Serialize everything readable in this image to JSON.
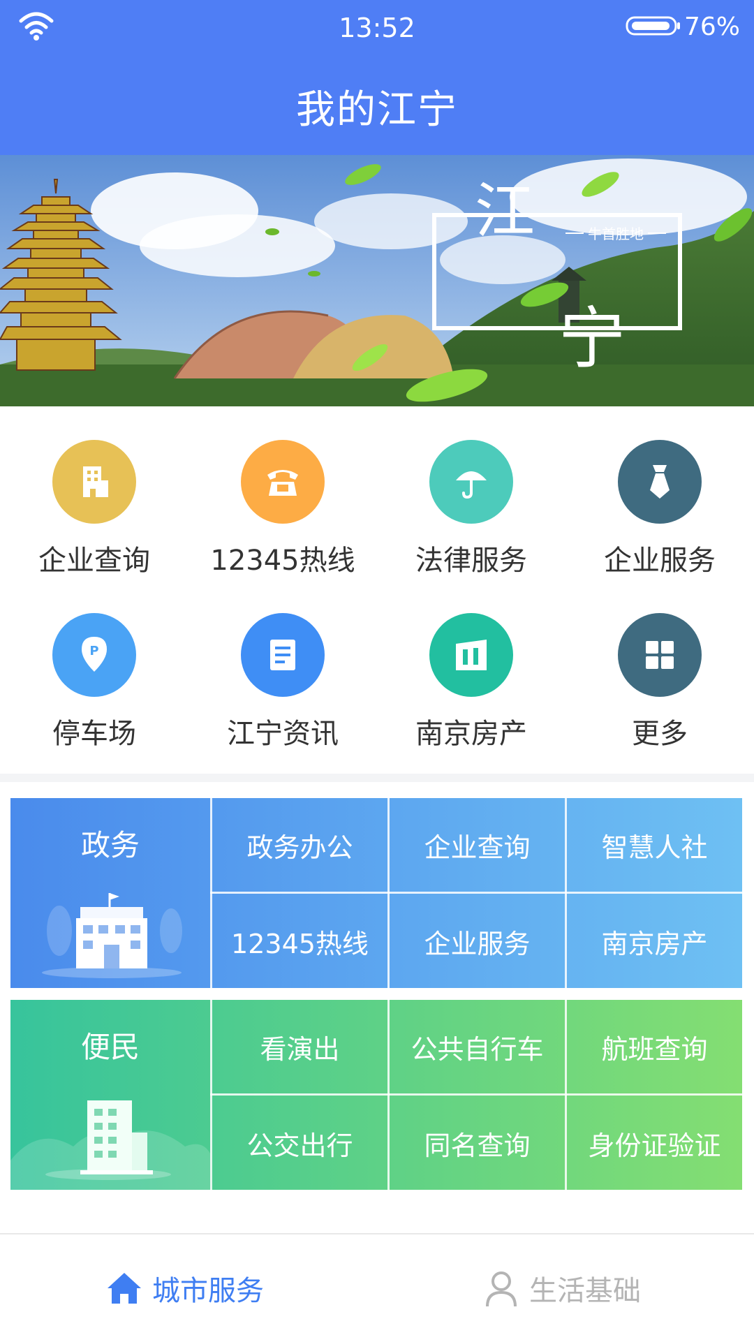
{
  "status": {
    "time": "13:52",
    "battery": "76%"
  },
  "title": "我的江宁",
  "banner": {
    "big_chars": [
      "江",
      "宁"
    ],
    "slogan": "牛首胜地"
  },
  "grid": [
    {
      "label": "企业查询",
      "color": "#e7c156",
      "icon": "building-icon"
    },
    {
      "label": "12345热线",
      "color": "#fdac45",
      "icon": "phone-icon"
    },
    {
      "label": "法律服务",
      "color": "#4dcbbb",
      "icon": "umbrella-icon"
    },
    {
      "label": "企业服务",
      "color": "#3f6b80",
      "icon": "tie-icon"
    },
    {
      "label": "停车场",
      "color": "#4aa3f5",
      "icon": "parking-pin-icon"
    },
    {
      "label": "江宁资讯",
      "color": "#3f8ef5",
      "icon": "document-icon"
    },
    {
      "label": "南京房产",
      "color": "#22bfa0",
      "icon": "house-icon"
    },
    {
      "label": "更多",
      "color": "#3f6b80",
      "icon": "grid-icon"
    }
  ],
  "panels": [
    {
      "title": "政务",
      "icon": "government-building-icon",
      "colors": [
        "#4a8bec",
        "#6ec0f3"
      ],
      "cells": [
        "政务办公",
        "企业查询",
        "智慧人社",
        "12345热线",
        "企业服务",
        "南京房产"
      ]
    },
    {
      "title": "便民",
      "icon": "apartment-building-icon",
      "colors": [
        "#37c49c",
        "#84de72"
      ],
      "cells": [
        "看演出",
        "公共自行车",
        "航班查询",
        "公交出行",
        "同名查询",
        "身份证验证"
      ]
    }
  ],
  "nav": [
    {
      "label": "城市服务",
      "icon": "home-icon",
      "active": true,
      "color": "#3f7ef2"
    },
    {
      "label": "生活基础",
      "icon": "user-icon",
      "active": false,
      "color": "#b4b4b4"
    }
  ]
}
